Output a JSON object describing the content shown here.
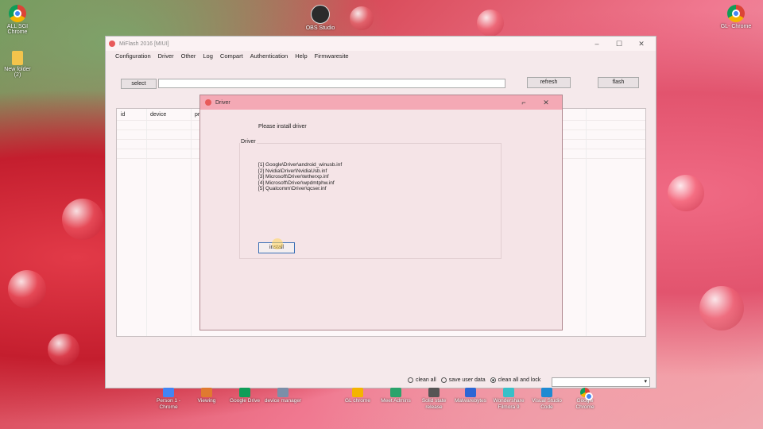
{
  "desktop": {
    "icons": [
      {
        "label": "ALL SGI\nChrome",
        "icon": "chrome-icon"
      },
      {
        "label": "New folder\n(2)",
        "icon": "folder-icon"
      },
      {
        "label": "OBS Studio",
        "icon": "obs-icon"
      },
      {
        "label": "GL- Chrome",
        "icon": "chrome-icon"
      }
    ],
    "bottom_icons": [
      "Person 1 -\nChrome",
      "Viewing",
      "Google Drive",
      "device manager",
      "GL chrome",
      "Meet Admins",
      "Solid state\nrelease",
      "Malwarebytes",
      "Wondershare\nFilmora 9",
      "Visual Studio\nCode",
      "Google\nChrome"
    ]
  },
  "main_window": {
    "title": "MiFlash 2016 [MIUI]",
    "menu": [
      "Configuration",
      "Driver",
      "Other",
      "Log",
      "Compart",
      "Authentication",
      "Help",
      "Firmwaresite"
    ],
    "select_label": "select",
    "path_value": "",
    "refresh_label": "refresh",
    "flash_label": "flash",
    "grid_headers": [
      "id",
      "device",
      "pro"
    ],
    "bottom": {
      "clean_all": "clean all",
      "save_user_data": "save user data",
      "clean_all_and_lock": "clean all and lock",
      "selected": "clean_all_and_lock"
    }
  },
  "driver_dialog": {
    "title": "Driver",
    "message": "Please install driver",
    "group_label": "Driver",
    "drivers": [
      "[1] Google\\Driver\\android_winusb.inf",
      "[2] Nvidia\\Driver\\NvidiaUsb.inf",
      "[3] Microsoft\\Driver\\tetherxp.inf",
      "[4] Microsoft\\Driver\\wpdmtphw.inf",
      "[5] Qualcomm\\Driver\\qcser.inf"
    ],
    "install_label": "install"
  },
  "colors": {
    "dialog_title": "#f4a9b5",
    "accent_border": "#3a6fb5"
  }
}
